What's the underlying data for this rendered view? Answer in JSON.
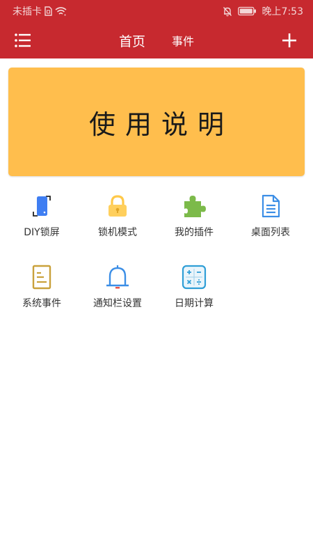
{
  "status_bar": {
    "carrier": "未插卡",
    "time": "晚上7:53",
    "icons": [
      "sim-card-icon",
      "wifi-icon",
      "bell-off-icon",
      "battery-icon"
    ]
  },
  "header": {
    "tabs": [
      {
        "label": "首页",
        "active": true
      },
      {
        "label": "事件",
        "active": false
      }
    ],
    "menu_icon": "list-menu-icon",
    "add_icon": "plus-icon",
    "background_color": "#c7292f"
  },
  "banner": {
    "title": "使用说明",
    "background_color": "#ffbe4d"
  },
  "grid": {
    "items": [
      {
        "label": "DIY锁屏",
        "icon": "phone-frame-icon"
      },
      {
        "label": "锁机模式",
        "icon": "lock-icon"
      },
      {
        "label": "我的插件",
        "icon": "puzzle-icon"
      },
      {
        "label": "桌面列表",
        "icon": "document-icon"
      },
      {
        "label": "系统事件",
        "icon": "notepad-icon"
      },
      {
        "label": "通知栏设置",
        "icon": "bell-icon"
      },
      {
        "label": "日期计算",
        "icon": "calculator-icon"
      }
    ]
  }
}
